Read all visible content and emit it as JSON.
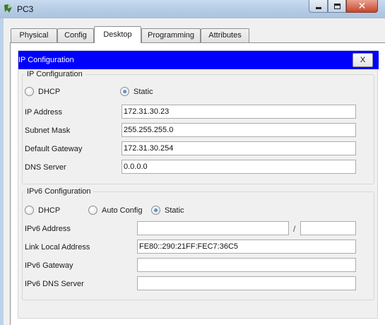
{
  "window": {
    "title": "PC3",
    "minimize_glyph": "minimize-glyph",
    "maximize_glyph": "maximize-glyph",
    "close_glyph": "✕"
  },
  "tabs": [
    {
      "label": "Physical",
      "active": false
    },
    {
      "label": "Config",
      "active": false
    },
    {
      "label": "Desktop",
      "active": true
    },
    {
      "label": "Programming",
      "active": false
    },
    {
      "label": "Attributes",
      "active": false
    }
  ],
  "ip_config": {
    "header_title": "IP Configuration",
    "close_label": "X",
    "ipv4": {
      "group_title": "IP Configuration",
      "dhcp_label": "DHCP",
      "static_label": "Static",
      "mode": "Static",
      "ip_address": {
        "label": "IP Address",
        "value": "172.31.30.23"
      },
      "subnet_mask": {
        "label": "Subnet Mask",
        "value": "255.255.255.0"
      },
      "default_gateway": {
        "label": "Default Gateway",
        "value": "172.31.30.254"
      },
      "dns_server": {
        "label": "DNS Server",
        "value": "0.0.0.0"
      }
    },
    "ipv6": {
      "group_title": "IPv6 Configuration",
      "dhcp_label": "DHCP",
      "auto_label": "Auto Config",
      "static_label": "Static",
      "mode": "Static",
      "address": {
        "label": "IPv6 Address",
        "value": "",
        "prefix": ""
      },
      "prefix_separator": "/",
      "link_local": {
        "label": "Link Local Address",
        "value": "FE80::290:21FF:FEC7:36C5"
      },
      "gateway": {
        "label": "IPv6 Gateway",
        "value": ""
      },
      "dns_server": {
        "label": "IPv6 DNS Server",
        "value": ""
      }
    }
  },
  "colors": {
    "header_bar": "#0000ff",
    "close_button": "#c7452c",
    "title_bar": "#b7cde6"
  }
}
